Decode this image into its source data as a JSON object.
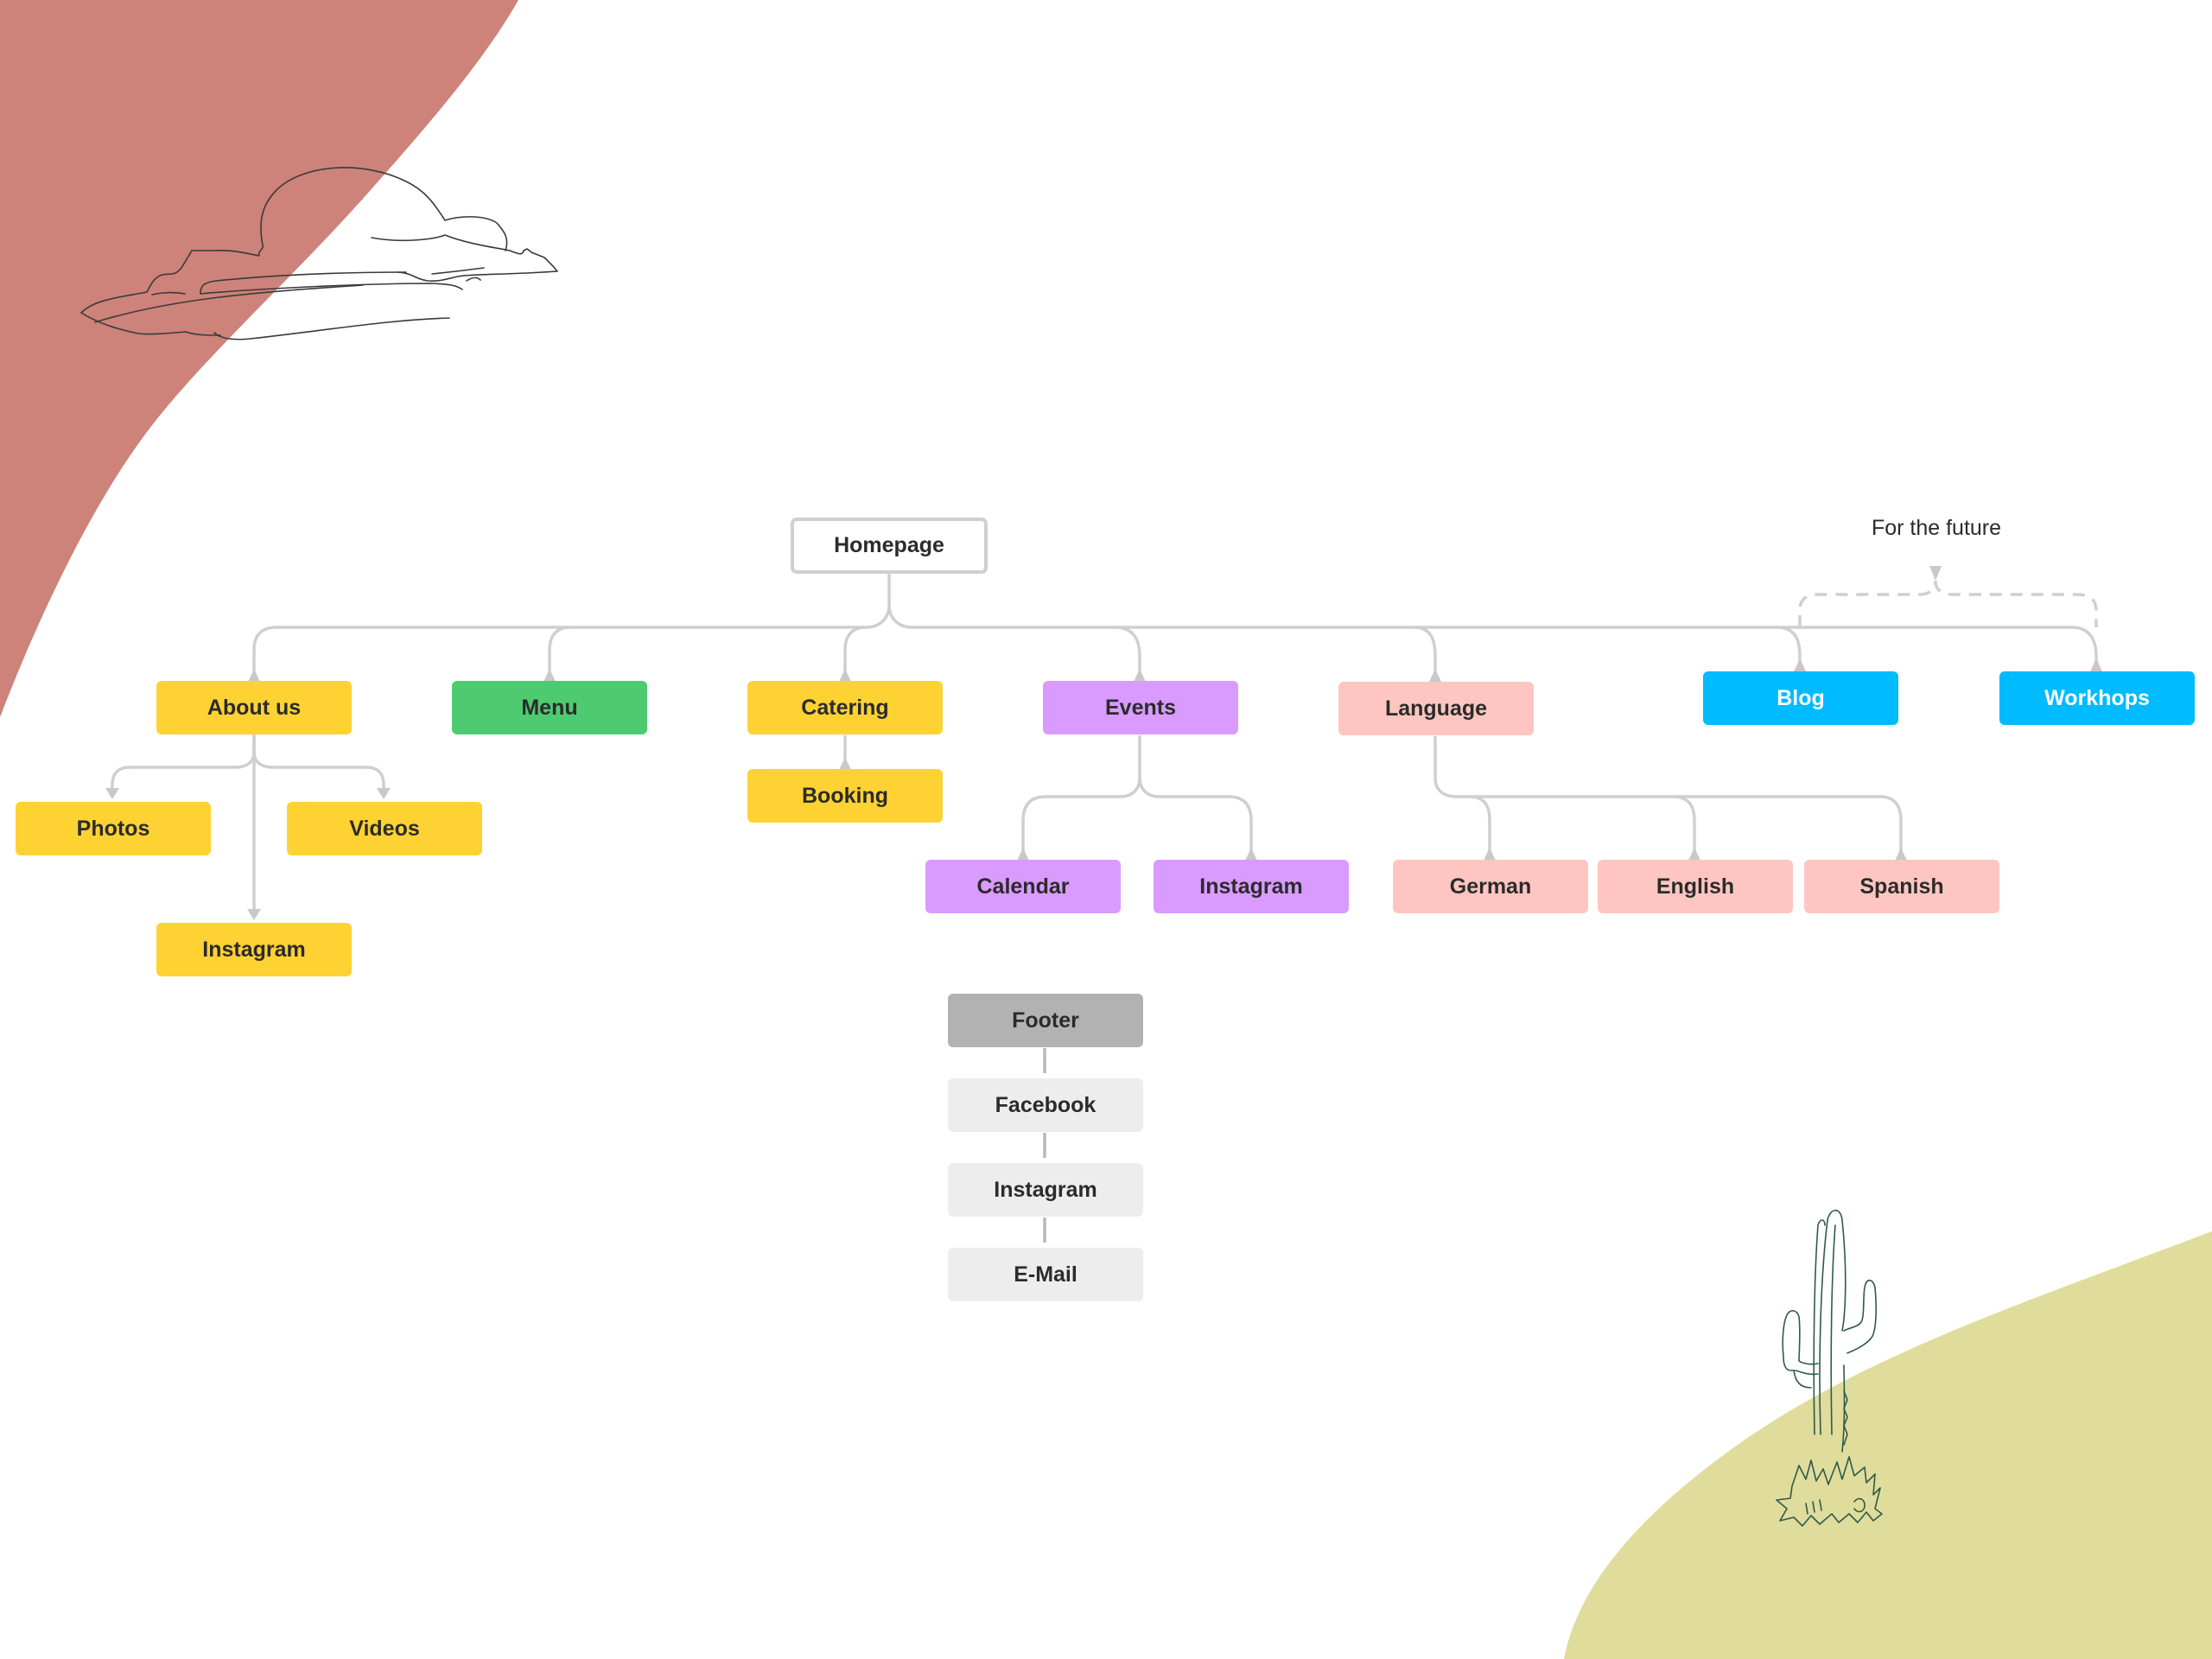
{
  "colors": {
    "accent_red_blob": "#cd8379",
    "accent_olive_blob": "#e0dc9b",
    "connector": "#cfcfcf",
    "about_group": "#ffd233",
    "menu": "#4ecb71",
    "events_group": "#d99bff",
    "language_group": "#ffc6c1",
    "future_group": "#00bbff",
    "footer_header": "#b2b2b2",
    "footer_items": "#ededed"
  },
  "decorations": {
    "top_left_illustration": "cloud-icon",
    "bottom_right_illustration": "cactus-icon"
  },
  "sitemap": {
    "root": {
      "label": "Homepage"
    },
    "sections": {
      "about": {
        "label": "About us",
        "children": [
          "Photos",
          "Videos",
          "Instagram"
        ]
      },
      "menu": {
        "label": "Menu"
      },
      "catering": {
        "label": "Catering",
        "children": [
          "Booking"
        ]
      },
      "events": {
        "label": "Events",
        "children": [
          "Calendar",
          "Instagram"
        ]
      },
      "language": {
        "label": "Language",
        "children": [
          "German",
          "English",
          "Spanish"
        ]
      },
      "blog": {
        "label": "Blog"
      },
      "workshops": {
        "label": "Workhops"
      }
    },
    "future_note": "For the future",
    "footer": {
      "label": "Footer",
      "items": [
        "Facebook",
        "Instagram",
        "E-Mail"
      ]
    }
  }
}
